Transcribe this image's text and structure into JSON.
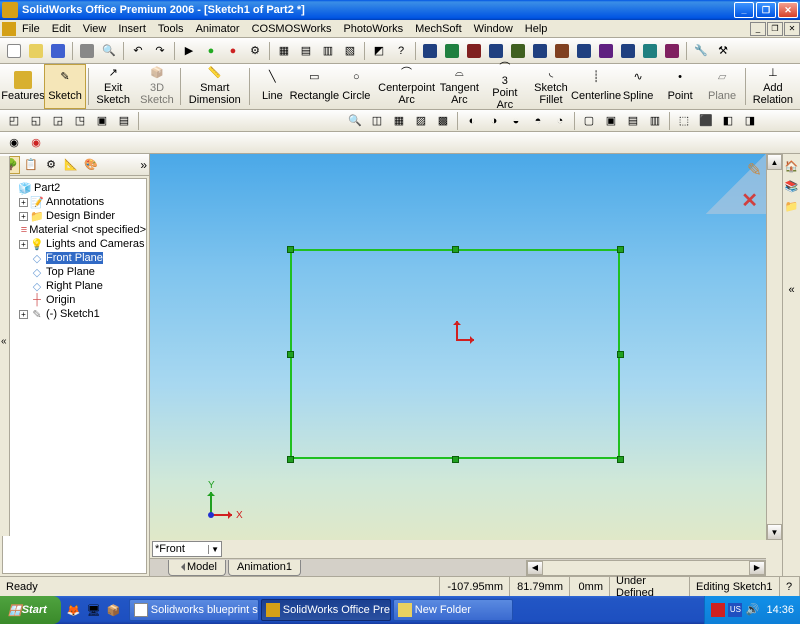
{
  "title": "SolidWorks Office Premium 2006 - [Sketch1 of Part2 *]",
  "menubar": [
    "File",
    "Edit",
    "View",
    "Insert",
    "Tools",
    "Animator",
    "COSMOSWorks",
    "PhotoWorks",
    "MechSoft",
    "Window",
    "Help"
  ],
  "big_toolbar": {
    "features": "Features",
    "sketch": "Sketch",
    "exit_sketch": "Exit Sketch",
    "3d_sketch": "3D Sketch",
    "smart_dimension": "Smart Dimension",
    "line": "Line",
    "rectangle": "Rectangle",
    "circle": "Circle",
    "centerpoint_arc": "Centerpoint Arc",
    "tangent_arc": "Tangent Arc",
    "3point_arc": "3 Point Arc",
    "sketch_fillet": "Sketch Fillet",
    "centerline": "Centerline",
    "spline": "Spline",
    "point": "Point",
    "plane": "Plane",
    "add_relation": "Add Relation"
  },
  "tree": {
    "root": "Part2",
    "items": [
      {
        "label": "Annotations",
        "icon": "#d8b030",
        "exp": "+"
      },
      {
        "label": "Design Binder",
        "icon": "#d8b030",
        "exp": "+"
      },
      {
        "label": "Material <not specified>",
        "icon": "#d05050"
      },
      {
        "label": "Lights and Cameras",
        "icon": "#d8b030",
        "exp": "+"
      },
      {
        "label": "Front Plane",
        "icon": "#70a0d8",
        "sel": true
      },
      {
        "label": "Top Plane",
        "icon": "#70a0d8"
      },
      {
        "label": "Right Plane",
        "icon": "#70a0d8"
      },
      {
        "label": "Origin",
        "icon": "#d05050"
      },
      {
        "label": "(-) Sketch1",
        "icon": "#808080",
        "exp": "+"
      }
    ]
  },
  "view_dropdown": "*Front",
  "bottom_tabs": [
    "Model",
    "Animation1"
  ],
  "statusbar": {
    "ready": "Ready",
    "x": "-107.95mm",
    "y": "81.79mm",
    "z": "0mm",
    "state": "Under Defined",
    "mode": "Editing Sketch1"
  },
  "taskbar": {
    "start": "Start",
    "tasks": [
      {
        "label": "Solidworks blueprint setu...",
        "active": false,
        "color": "#fff"
      },
      {
        "label": "SolidWorks Office Pre...",
        "active": true,
        "color": "#d4a017"
      },
      {
        "label": "New Folder",
        "active": false,
        "color": "#e8d060"
      }
    ],
    "clock": "14:36",
    "tray_lang": "US"
  },
  "triad": {
    "x": "X",
    "y": "Y"
  }
}
